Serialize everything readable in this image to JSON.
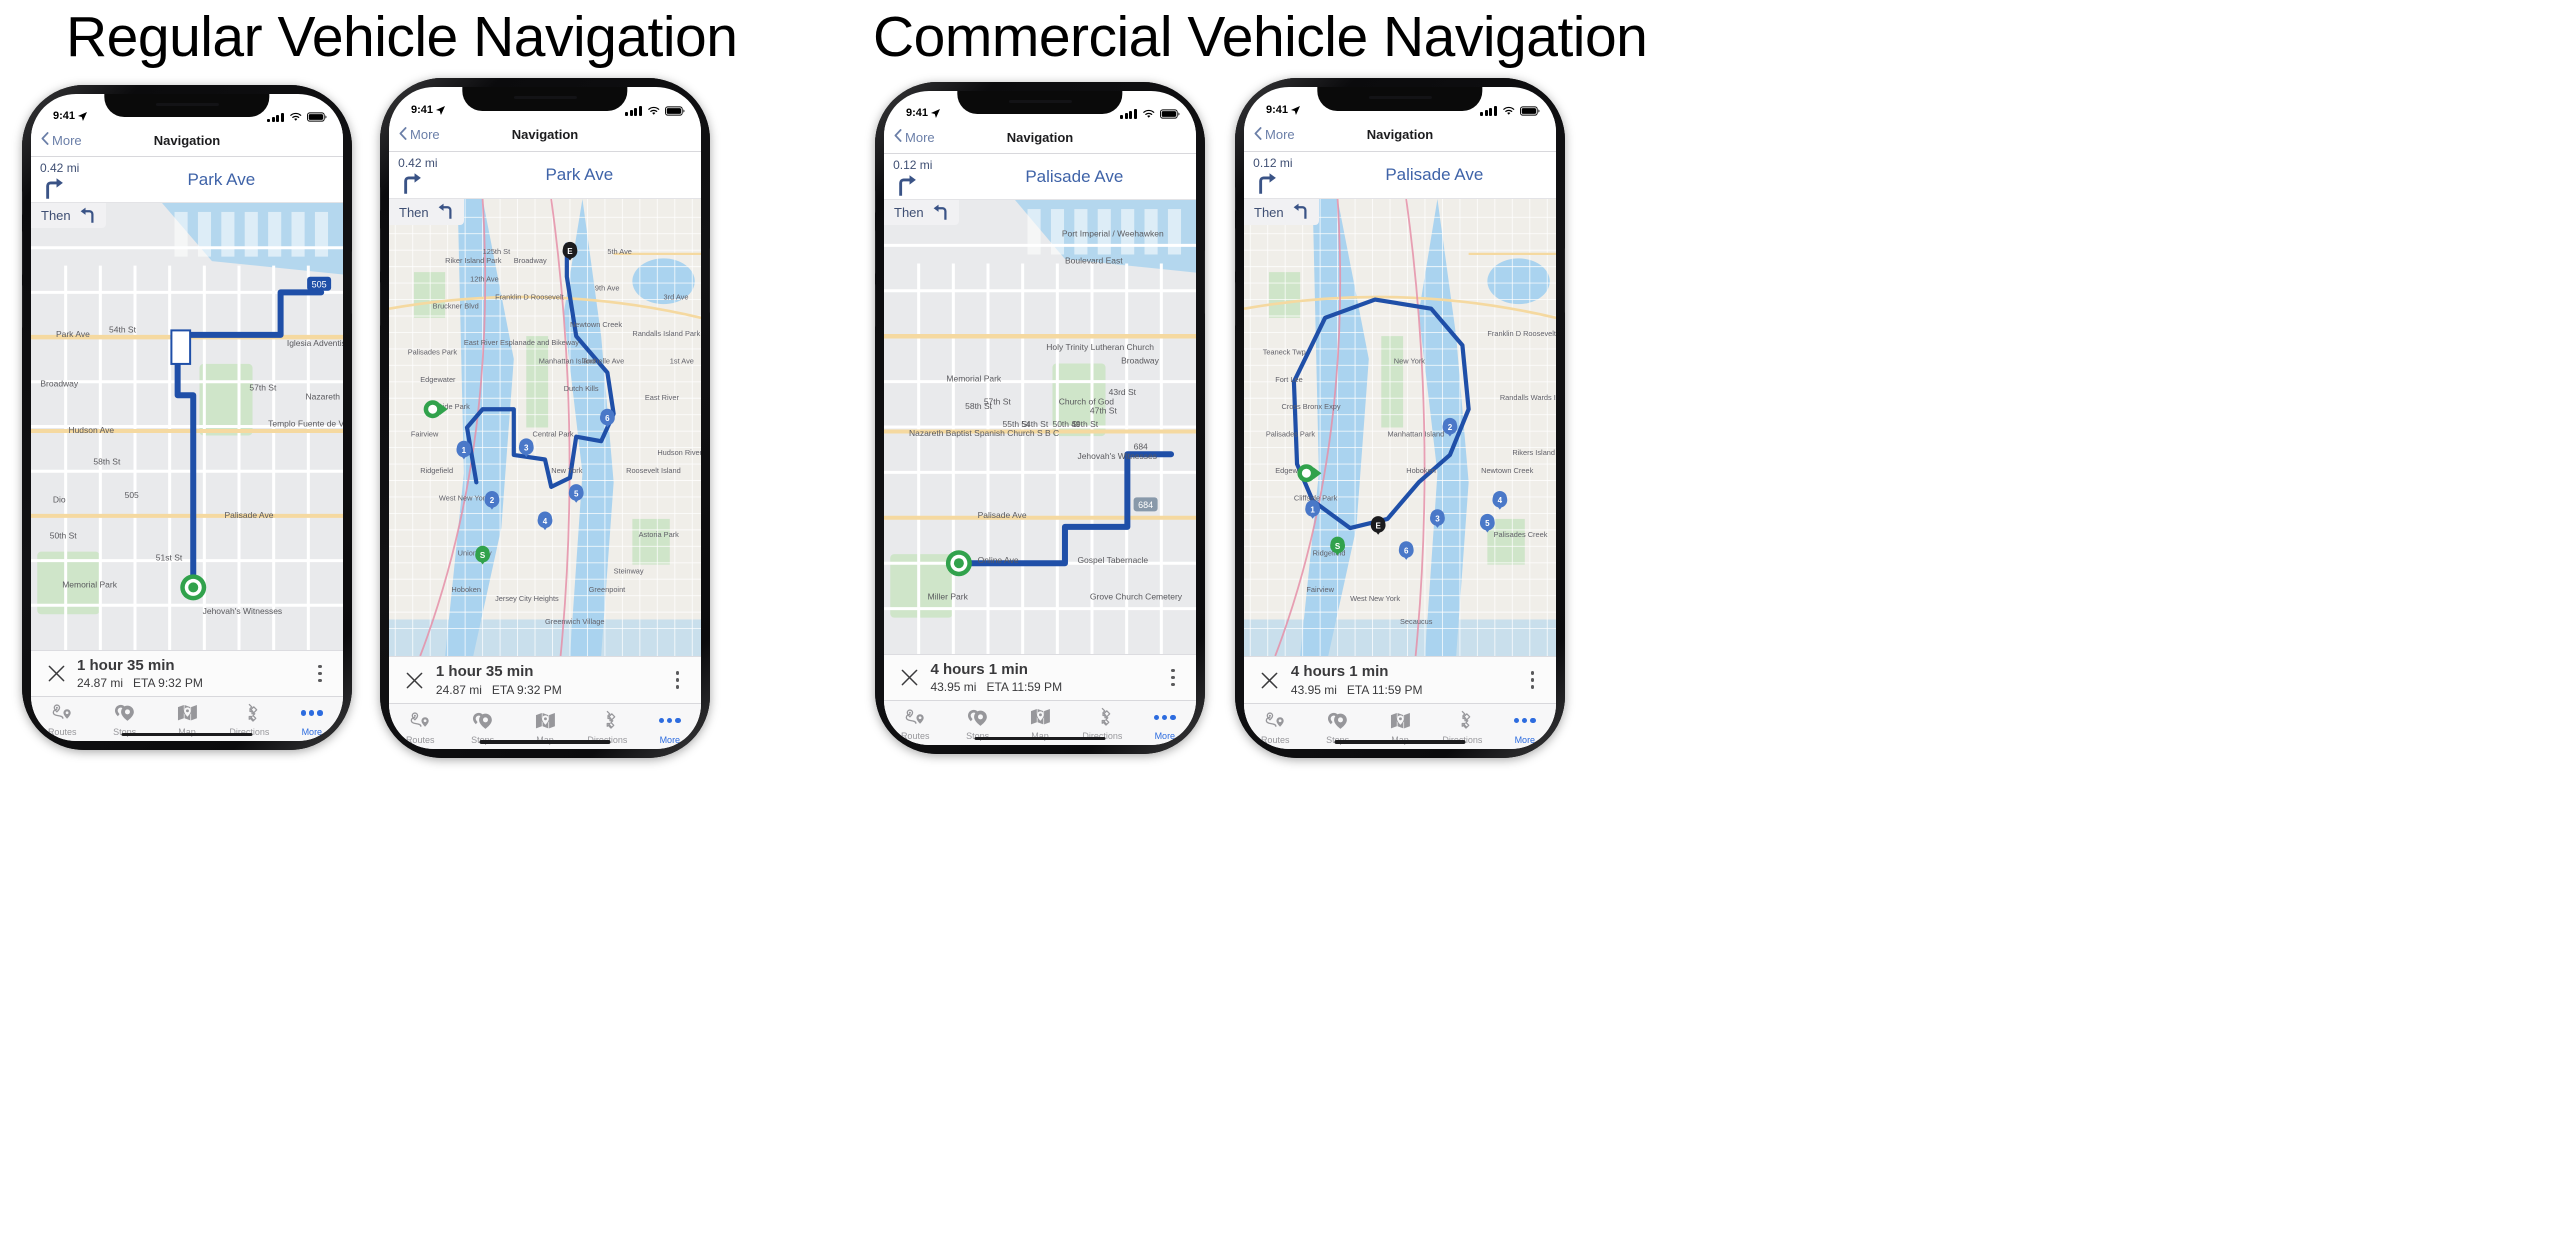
{
  "headings": {
    "regular": "Regular Vehicle Navigation",
    "commercial": "Commercial Vehicle Navigation"
  },
  "colors": {
    "route_blue": "#1f4fa8",
    "street_blue": "#3f63a8",
    "accent_blue": "#2d6cdf",
    "start_green": "#31a24c",
    "end_black": "#1c1c1e",
    "map_water": "#aad3ef",
    "map_land": "#e9eaec",
    "map_park": "#cfe5c9",
    "map_road": "#ffffff",
    "map_highway": "#f5d9a0",
    "map_rail": "#e58fa8"
  },
  "statusbar": {
    "time": "9:41",
    "location_icon": "location-arrow-icon",
    "signal_icon": "cellular-signal-icon",
    "wifi_icon": "wifi-icon",
    "battery_icon": "battery-full-icon"
  },
  "navbar": {
    "back_label": "More",
    "back_icon": "chevron-left-icon",
    "title": "Navigation"
  },
  "tabs": [
    {
      "label": "Routes",
      "icon": "routes-icon",
      "active": false
    },
    {
      "label": "Stops",
      "icon": "stops-icon",
      "active": false
    },
    {
      "label": "Map",
      "icon": "map-icon",
      "active": false
    },
    {
      "label": "Directions",
      "icon": "directions-icon",
      "active": false
    },
    {
      "label": "More",
      "icon": "more-dots-icon",
      "active": true
    }
  ],
  "eta_common": {
    "close_icon": "close-x-icon",
    "menu_icon": "overflow-menu-icon"
  },
  "phones": [
    {
      "id": "regular-street-view",
      "group": "Regular Vehicle Navigation",
      "instruction": {
        "distance": "0.42 mi",
        "street": "Park Ave",
        "maneuver_icon": "turn-right-icon",
        "then_label": "Then",
        "then_icon": "turn-left-icon"
      },
      "eta": {
        "duration": "1 hour 35 min",
        "distance": "24.87 mi",
        "arrival": "ETA 9:32 PM"
      },
      "map": {
        "view": "street-level",
        "labels": [
          "Park Ave",
          "Broadway",
          "Hudson Ave",
          "Palisade Ave",
          "58th St",
          "57th St",
          "54th St",
          "51st St",
          "50th St",
          "Memorial Park",
          "Iglesia Adventista del Septimo",
          "Nazareth Baptist Spanish Church S B C",
          "Templo Fuente de Vida",
          "Jehovah's Witnesses",
          "Dio",
          "505"
        ],
        "markers": [
          {
            "type": "vehicle-position",
            "label": ""
          }
        ]
      }
    },
    {
      "id": "regular-overview",
      "group": "Regular Vehicle Navigation",
      "instruction": {
        "distance": "0.42 mi",
        "street": "Park Ave",
        "maneuver_icon": "turn-right-icon",
        "then_label": "Then",
        "then_icon": "turn-left-icon"
      },
      "eta": {
        "duration": "1 hour 35 min",
        "distance": "24.87 mi",
        "arrival": "ETA 9:32 PM"
      },
      "map": {
        "view": "route-overview",
        "labels": [
          "Palisades Park",
          "Edgewater",
          "Cliffside Park",
          "Fairview",
          "Ridgefield",
          "West New York",
          "Union City",
          "Hoboken",
          "Jersey City Heights",
          "Greenwich Village",
          "New York",
          "Manhattan Island",
          "Central Park",
          "Randalls Island Park",
          "East River",
          "Hudson River",
          "Roosevelt Island",
          "Astoria Park",
          "Steinway",
          "Greenpoint",
          "Newtown Creek",
          "Franklin D Roosevelt",
          "Broadway",
          "125th St",
          "12th Ave",
          "9th Ave",
          "5th Ave",
          "3rd Ave",
          "1st Ave",
          "Bruckner Blvd",
          "Riker Island Park",
          "East River Esplanade and Bikeway",
          "Dutch Kills",
          "Tonnelle Ave"
        ],
        "markers": [
          {
            "type": "start",
            "label": "S"
          },
          {
            "type": "end",
            "label": "E"
          },
          {
            "type": "stop",
            "label": "1"
          },
          {
            "type": "stop",
            "label": "2"
          },
          {
            "type": "stop",
            "label": "3"
          },
          {
            "type": "stop",
            "label": "4"
          },
          {
            "type": "stop",
            "label": "5"
          },
          {
            "type": "stop",
            "label": "6"
          },
          {
            "type": "vehicle-position",
            "label": ""
          }
        ]
      }
    },
    {
      "id": "commercial-street-view",
      "group": "Commercial Vehicle Navigation",
      "instruction": {
        "distance": "0.12 mi",
        "street": "Palisade Ave",
        "maneuver_icon": "turn-right-icon",
        "then_label": "Then",
        "then_icon": "turn-left-icon"
      },
      "eta": {
        "duration": "4 hours 1 min",
        "distance": "43.95 mi",
        "arrival": "ETA 11:59 PM"
      },
      "map": {
        "view": "street-level",
        "labels": [
          "Palisade Ave",
          "Broadway",
          "Boulevard East",
          "Port Imperial / Weehawken",
          "Memorial Park",
          "Holy Trinity Lutheran Church",
          "Church of God",
          "Nazareth Baptist Spanish Church S B C",
          "Jehovah's Witnesses",
          "Gospel Tabernacle",
          "Grove Church Cemetery",
          "Miller Park",
          "58th St",
          "57th St",
          "55th St",
          "54th St",
          "50th St",
          "49th St",
          "47th St",
          "43rd St",
          "684",
          "Online Ave"
        ],
        "markers": [
          {
            "type": "vehicle-position",
            "label": ""
          }
        ]
      }
    },
    {
      "id": "commercial-overview",
      "group": "Commercial Vehicle Navigation",
      "instruction": {
        "distance": "0.12 mi",
        "street": "Palisade Ave",
        "maneuver_icon": "turn-right-icon",
        "then_label": "Then",
        "then_icon": "turn-left-icon"
      },
      "eta": {
        "duration": "4 hours 1 min",
        "distance": "43.95 mi",
        "arrival": "ETA 11:59 PM"
      },
      "map": {
        "view": "route-overview",
        "labels": [
          "Teaneck Twp",
          "Fort Lee",
          "Cross Bronx Expy",
          "Palisades Park",
          "Edgewater",
          "Cliffside Park",
          "Ridgefield",
          "Fairview",
          "West New York",
          "Secaucus",
          "Hoboken",
          "New York",
          "Manhattan Island",
          "Franklin D Roosevelt",
          "Randalls Wards Island",
          "Rikers Island",
          "Newtown Creek",
          "Palisades Creek"
        ],
        "markers": [
          {
            "type": "start",
            "label": "S"
          },
          {
            "type": "end",
            "label": "E"
          },
          {
            "type": "stop",
            "label": "1"
          },
          {
            "type": "stop",
            "label": "2"
          },
          {
            "type": "stop",
            "label": "3"
          },
          {
            "type": "stop",
            "label": "4"
          },
          {
            "type": "stop",
            "label": "5"
          },
          {
            "type": "stop",
            "label": "6"
          },
          {
            "type": "vehicle-position",
            "label": ""
          }
        ]
      }
    }
  ]
}
